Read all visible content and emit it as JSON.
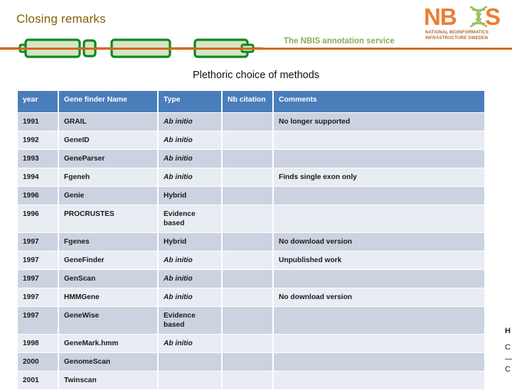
{
  "slide": {
    "title": "Closing remarks",
    "subtitle": "Plethoric choice of methods",
    "tagline": "The NBIS annotation service"
  },
  "logo": {
    "wordmark": "NBIS",
    "subtitle_line1": "NATIONAL BIOINFORMATICS",
    "subtitle_line2": "INFRASTRUCTURE SWEDEN",
    "brand_color": "#ED7D31",
    "dna_color": "#9FBF5C"
  },
  "colors": {
    "title_text": "#7f6000",
    "rule": "#d2691e",
    "tagline_text": "#8aab5a",
    "table_header_bg": "#4a7ebb",
    "table_header_text": "#ffffff",
    "row_dark_bg": "#ccd3e0",
    "row_light_bg": "#e8ecf3",
    "exon_fill": "#d6e4c3",
    "exon_stroke": "#0a8a21",
    "intron_line": "#d2691e"
  },
  "table": {
    "columns": [
      "year",
      "Gene finder Name",
      "Type",
      "Nb citation",
      "Comments"
    ],
    "rows": [
      {
        "year": "1991",
        "name": "GRAIL",
        "type": "Ab initio",
        "type_italic": true,
        "citation": "",
        "comments": "No longer supported"
      },
      {
        "year": "1992",
        "name": "GeneID",
        "type": "Ab initio",
        "type_italic": true,
        "citation": "",
        "comments": ""
      },
      {
        "year": "1993",
        "name": "GeneParser",
        "type": "Ab initio",
        "type_italic": true,
        "citation": "",
        "comments": ""
      },
      {
        "year": "1994",
        "name": "Fgeneh",
        "type": "Ab initio",
        "type_italic": true,
        "citation": "",
        "comments": "Finds single exon only"
      },
      {
        "year": "1996",
        "name": "Genie",
        "type": "Hybrid",
        "type_italic": false,
        "citation": "",
        "comments": ""
      },
      {
        "year": "1996",
        "name": "PROCRUSTES",
        "type": "Evidence based",
        "type_italic": false,
        "citation": "",
        "comments": ""
      },
      {
        "year": "1997",
        "name": "Fgenes",
        "type": "Hybrid",
        "type_italic": false,
        "citation": "",
        "comments": "No download version"
      },
      {
        "year": "1997",
        "name": "GeneFinder",
        "type": "Ab initio",
        "type_italic": true,
        "citation": "",
        "comments": "Unpublished work"
      },
      {
        "year": "1997",
        "name": "GenScan",
        "type": "Ab initio",
        "type_italic": true,
        "citation": "",
        "comments": ""
      },
      {
        "year": "1997",
        "name": "HMMGene",
        "type": "Ab initio",
        "type_italic": true,
        "citation": "",
        "comments": "No download version"
      },
      {
        "year": "1997",
        "name": "GeneWise",
        "type": "Evidence based",
        "type_italic": false,
        "citation": "",
        "comments": ""
      },
      {
        "year": "1998",
        "name": "GeneMark.hmm",
        "type": "Ab initio",
        "type_italic": true,
        "citation": "",
        "comments": ""
      },
      {
        "year": "2000",
        "name": "GenomeScan",
        "type": "",
        "type_italic": false,
        "citation": "",
        "comments": ""
      },
      {
        "year": "2001",
        "name": "Twinscan",
        "type": "",
        "type_italic": false,
        "citation": "",
        "comments": ""
      }
    ]
  },
  "edge_fragments": {
    "line1": "H",
    "line2": "C",
    "line3": "C"
  }
}
